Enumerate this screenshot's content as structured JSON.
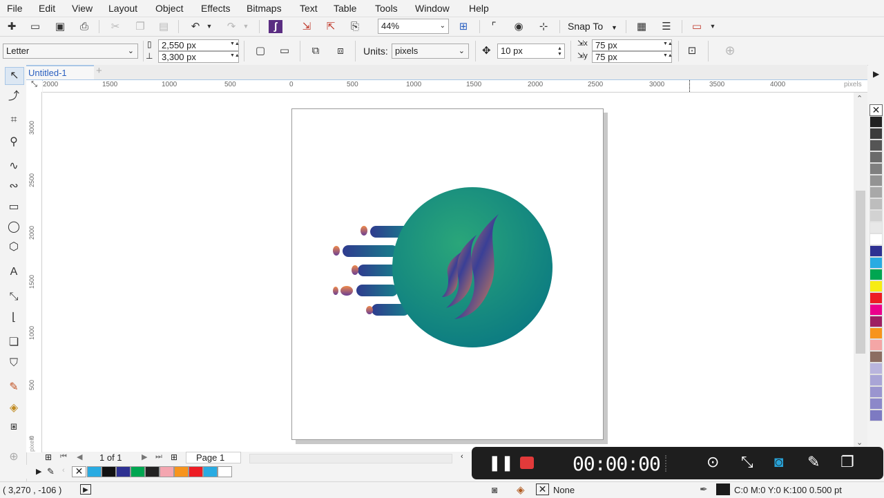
{
  "menu": [
    "File",
    "Edit",
    "View",
    "Layout",
    "Object",
    "Effects",
    "Bitmaps",
    "Text",
    "Table",
    "Tools",
    "Window",
    "Help"
  ],
  "toolbar": {
    "zoom_value": "44%",
    "snap_label": "Snap To"
  },
  "property_bar": {
    "page_size": "Letter",
    "width": "2,550 px",
    "height": "3,300 px",
    "units_label": "Units:",
    "units_value": "pixels",
    "nudge": "10 px",
    "dup_x": "75 px",
    "dup_y": "75 px"
  },
  "doc_tab": {
    "title": "Untitled-1",
    "add_label": "+"
  },
  "ruler": {
    "h_labels": [
      "2000",
      "1500",
      "1000",
      "500",
      "0",
      "500",
      "1000",
      "1500",
      "2000",
      "2500",
      "3000",
      "3500",
      "4000",
      "pixels"
    ],
    "v_labels": [
      "3000",
      "2500",
      "2000",
      "1500",
      "1000",
      "500",
      "0"
    ],
    "v_unit": "pixels"
  },
  "navigation": {
    "page_count": "1 of 1",
    "page_tab": "Page 1"
  },
  "status": {
    "coords": "( 3,270 , -106  )",
    "fill_label": "None",
    "outline_info": "C:0 M:0 Y:0 K:100  0.500 pt"
  },
  "recorder": {
    "timer": "00:00:00"
  },
  "colors": {
    "accent": "#2a5fc0",
    "logo_circle_light": "#2aa67a",
    "logo_circle_dark": "#0b7a82",
    "logo_stripe": "#2f3b8f",
    "logo_orange": "#ef8a4a",
    "palette": [
      "#222222",
      "#3c3c3c",
      "#555555",
      "#6b6b6b",
      "#7f7f7f",
      "#939393",
      "#a8a8a8",
      "#bdbdbd",
      "#d2d2d2",
      "#e8e8e8",
      "#ffffff",
      "#2e3192",
      "#29abe2",
      "#00a651",
      "#f7ec13",
      "#ed1c24",
      "#ec008c",
      "#9e1f63",
      "#f7941d",
      "#f4a6a6",
      "#8c6d62",
      "#b9b5dd",
      "#a9a5d6",
      "#9a95cf",
      "#8c88c9",
      "#7d7ac2"
    ],
    "doc_palette": [
      "#29abe2",
      "#111111",
      "#2e3192",
      "#00a651",
      "#222222",
      "#f4a6b0",
      "#f7941d",
      "#ed1c24",
      "#29abe2",
      "#ffffff"
    ]
  }
}
